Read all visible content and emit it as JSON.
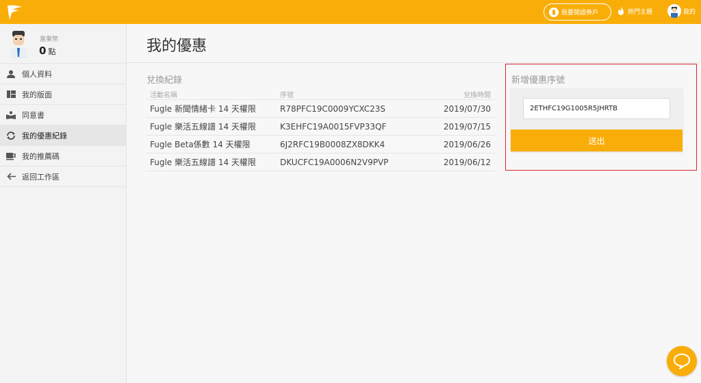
{
  "header": {
    "logo_icon": "fugle-logo",
    "open_account_label": "我要開證券戶",
    "hot_topics_label": "熱門主題",
    "me_label": "我的",
    "brand_color": "#f9ad08"
  },
  "sidebar": {
    "points_label": "富果幣",
    "points_value": "0",
    "points_unit": "點",
    "items": [
      {
        "label": "個人資料",
        "icon": "person-icon"
      },
      {
        "label": "我的版面",
        "icon": "layout-icon"
      },
      {
        "label": "同意書",
        "icon": "book-icon"
      },
      {
        "label": "我的優惠紀錄",
        "icon": "refresh-icon",
        "active": true
      },
      {
        "label": "我的推薦碼",
        "icon": "cup-icon"
      },
      {
        "label": "返回工作區",
        "icon": "arrow-left-icon"
      }
    ]
  },
  "main": {
    "title": "我的優惠",
    "records": {
      "title": "兌換紀錄",
      "columns": [
        "活動名稱",
        "序號",
        "兌換時間"
      ],
      "rows": [
        [
          "Fugle 新聞情緒卡 14 天權限",
          "R78PFC19C0009YCXC23S",
          "2019/07/30"
        ],
        [
          "Fugle 樂活五線譜 14 天權限",
          "K3EHFC19A0015FVP33QF",
          "2019/07/15"
        ],
        [
          "Fugle Beta係數 14 天權限",
          "6J2RFC19B0008ZX8DKK4",
          "2019/06/26"
        ],
        [
          "Fugle 樂活五線譜 14 天權限",
          "DKUCFC19A0006N2V9PVP",
          "2019/06/12"
        ]
      ]
    },
    "add": {
      "title": "新增優惠序號",
      "code_value": "2ETHFC19G1005R5JHRTB",
      "submit_label": "送出"
    }
  },
  "chat": {
    "icon": "chat-bubble-icon"
  }
}
